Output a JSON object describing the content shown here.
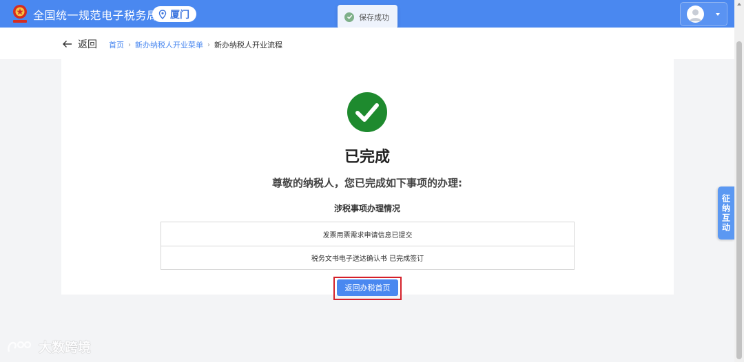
{
  "header": {
    "app_title": "全国统一规范电子税务局",
    "city": "厦门"
  },
  "toast": {
    "message": "保存成功"
  },
  "nav": {
    "back_label": "返回",
    "breadcrumb": [
      "首页",
      "新办纳税人开业菜单",
      "新办纳税人开业流程"
    ]
  },
  "result": {
    "title": "已完成",
    "subtitle": "尊敬的纳税人，您已完成如下事项的办理:",
    "section_title": "涉税事项办理情况",
    "items": [
      "发票用票需求申请信息已提交",
      "税务文书电子送达确认书 已完成签订"
    ],
    "home_button": "返回办税首页"
  },
  "side_tab": {
    "label": "征纳互动"
  },
  "watermark": {
    "text": "大数跨境"
  },
  "colors": {
    "primary": "#4a88f0",
    "success": "#1e8a2e",
    "highlight": "#d4202a"
  }
}
